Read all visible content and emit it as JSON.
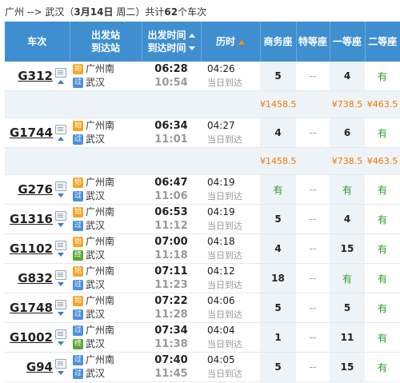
{
  "route": {
    "from": "广州",
    "arrow": "-->",
    "to": "武汉",
    "date_open": "（",
    "date": "3月14日",
    "weekday": "周二",
    "date_close": "）",
    "count_prefix": "共计",
    "count": "62",
    "count_suffix": "个车次"
  },
  "header": {
    "train": "车次",
    "station_from": "出发站",
    "station_to": "到达站",
    "time_dep": "出发时间",
    "time_arr": "到达时间",
    "duration": "历时",
    "business": "商务座",
    "special": "特等座",
    "first": "一等座",
    "second": "二等座"
  },
  "rows": [
    {
      "no": "G312",
      "from_badge": "始",
      "from": "广州南",
      "to_badge": "过",
      "to": "武汉",
      "dep": "06:28",
      "arr": "10:54",
      "dur": "04:26",
      "arrive_day": "当日到达",
      "biz": "5",
      "spc": "--",
      "fst": "4",
      "snd": "有",
      "sort": "up",
      "price": {
        "biz": "¥1458.5",
        "fst": "¥738.5",
        "snd": "¥463.5"
      }
    },
    {
      "no": "G1744",
      "from_badge": "始",
      "from": "广州南",
      "to_badge": "过",
      "to": "武汉",
      "dep": "06:34",
      "arr": "11:01",
      "dur": "04:27",
      "arrive_day": "当日到达",
      "biz": "4",
      "spc": "--",
      "fst": "6",
      "snd": "有",
      "sort": "up",
      "price": {
        "biz": "¥1458.5",
        "fst": "¥738.5",
        "snd": "¥463.5"
      }
    },
    {
      "no": "G276",
      "from_badge": "始",
      "from": "广州南",
      "to_badge": "过",
      "to": "武汉",
      "dep": "06:47",
      "arr": "11:06",
      "dur": "04:19",
      "arrive_day": "当日到达",
      "biz": "有",
      "spc": "--",
      "fst": "有",
      "snd": "有",
      "sort": "down"
    },
    {
      "no": "G1316",
      "from_badge": "始",
      "from": "广州南",
      "to_badge": "过",
      "to": "武汉",
      "dep": "06:53",
      "arr": "11:12",
      "dur": "04:19",
      "arrive_day": "当日到达",
      "biz": "5",
      "spc": "--",
      "fst": "4",
      "snd": "有",
      "sort": "down"
    },
    {
      "no": "G1102",
      "from_badge": "始",
      "from": "广州南",
      "to_badge": "终",
      "to": "武汉",
      "dep": "07:00",
      "arr": "11:18",
      "dur": "04:18",
      "arrive_day": "当日到达",
      "biz": "4",
      "spc": "--",
      "fst": "15",
      "snd": "有",
      "sort": "down"
    },
    {
      "no": "G832",
      "from_badge": "始",
      "from": "广州南",
      "to_badge": "过",
      "to": "武汉",
      "dep": "07:11",
      "arr": "11:23",
      "dur": "04:12",
      "arrive_day": "当日到达",
      "biz": "18",
      "spc": "--",
      "fst": "有",
      "snd": "有",
      "sort": "down"
    },
    {
      "no": "G1748",
      "from_badge": "始",
      "from": "广州南",
      "to_badge": "过",
      "to": "武汉",
      "dep": "07:22",
      "arr": "11:28",
      "dur": "04:06",
      "arrive_day": "当日到达",
      "biz": "5",
      "spc": "--",
      "fst": "5",
      "snd": "有",
      "sort": "down"
    },
    {
      "no": "G1002",
      "from_badge": "过",
      "from": "广州南",
      "to_badge": "终",
      "to": "武汉",
      "dep": "07:34",
      "arr": "11:38",
      "dur": "04:04",
      "arrive_day": "当日到达",
      "biz": "1",
      "spc": "--",
      "fst": "11",
      "snd": "有",
      "sort": "down"
    },
    {
      "no": "G94",
      "from_badge": "过",
      "from": "广州南",
      "to_badge": "过",
      "to": "武汉",
      "dep": "07:40",
      "arr": "11:45",
      "dur": "04:05",
      "arrive_day": "当日到达",
      "biz": "5",
      "spc": "--",
      "fst": "15",
      "snd": "有",
      "sort": "down"
    }
  ],
  "colors": {
    "header_bg": "#3f8fd0",
    "price": "#f07800",
    "available": "#2a9d2a",
    "badge_start": "#f5a623",
    "badge_pass": "#4a90d9",
    "badge_end": "#5aa830"
  }
}
